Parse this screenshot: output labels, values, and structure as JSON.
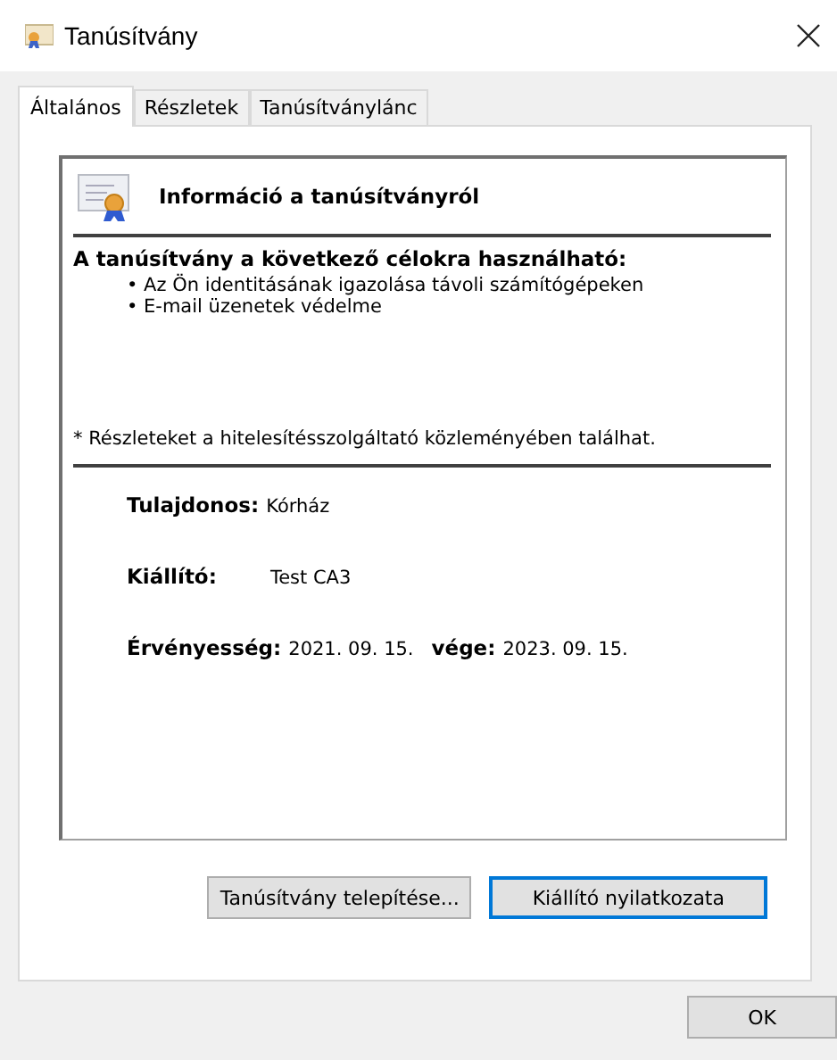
{
  "window": {
    "title": "Tanúsítvány"
  },
  "tabs": [
    {
      "label": "Általános",
      "selected": true
    },
    {
      "label": "Részletek",
      "selected": false
    },
    {
      "label": "Tanúsítványlánc",
      "selected": false
    }
  ],
  "info": {
    "heading": "Információ a tanúsítványról",
    "purpose_title": "A tanúsítvány a következő célokra használható:",
    "purposes": [
      "• Az Ön identitásának igazolása távoli számítógépeken",
      "• E-mail üzenetek védelme"
    ],
    "note": "* Részleteket a hitelesítésszolgáltató közleményében találhat.",
    "owner": {
      "label": "Tulajdonos:",
      "value": "Kórház"
    },
    "issuer": {
      "label": "Kiállító:",
      "value": "Test CA3"
    },
    "validity": {
      "label": "Érvényesség:",
      "from": "2021. 09. 15.",
      "to_label": "vége:",
      "to": "2023. 09. 15."
    }
  },
  "buttons": [
    {
      "label": "Tanúsítvány telepítése...",
      "focused": false
    },
    {
      "label": "Kiállító nyilatkozata",
      "focused": true
    }
  ],
  "footer_buttons": [
    {
      "label": "OK",
      "focused": false
    }
  ]
}
